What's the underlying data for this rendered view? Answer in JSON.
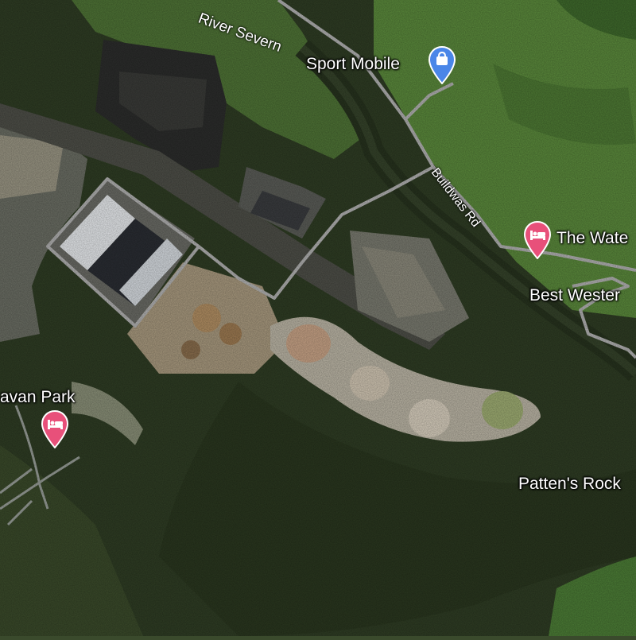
{
  "map": {
    "view": "satellite",
    "labels": {
      "river": "River Severn",
      "road": "Buildwas Rd",
      "place_patten": "Patten's Rock",
      "poi_sport": "Sport Mobile",
      "poi_hotel1": "The Wate",
      "poi_hotel2": "Best Wester",
      "poi_caravan": "avan Park"
    },
    "pins": {
      "sport": {
        "icon": "shopping-bag-icon",
        "color": "#4a86e8"
      },
      "hotel1": {
        "icon": "bed-icon",
        "color": "#e8507a"
      },
      "caravan": {
        "icon": "bed-icon",
        "color": "#e8507a"
      }
    }
  }
}
